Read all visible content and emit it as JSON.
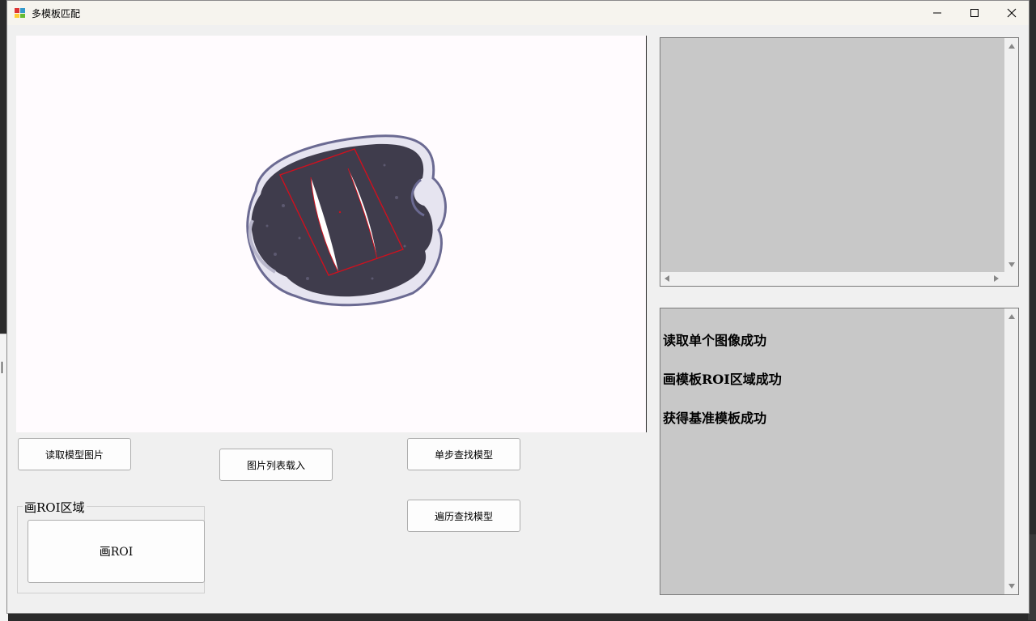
{
  "window": {
    "title": "多模板匹配"
  },
  "buttons": {
    "read_model_image": "读取模型图片",
    "load_image_list": "图片列表载入",
    "step_find_model": "单步查找模型",
    "traverse_find_model": "遍历查找模型"
  },
  "roi_group": {
    "title": "画ROI区域",
    "draw_roi_button": "画ROI"
  },
  "log": {
    "lines": [
      "读取单个图像成功",
      "画模板ROI区域成功",
      "获得基准模板成功"
    ]
  },
  "icons": {
    "app": "app-icon",
    "minimize": "minimize-icon",
    "maximize": "maximize-icon",
    "close": "close-icon"
  },
  "colors": {
    "roi_outline": "#d0101e",
    "panel_background": "#c8c8c8",
    "image_background": "#fffbfe"
  }
}
